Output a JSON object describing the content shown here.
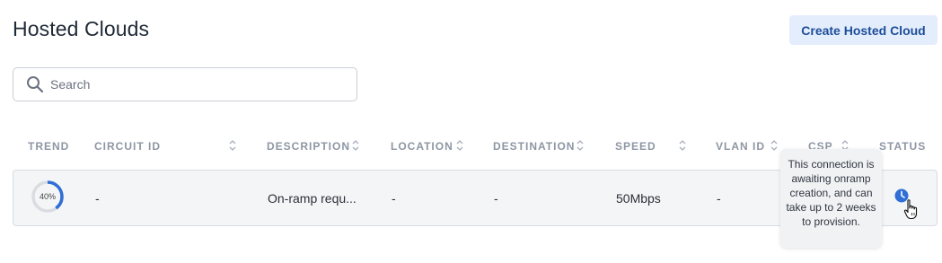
{
  "page": {
    "title": "Hosted Clouds"
  },
  "toolbar": {
    "create_label": "Create Hosted Cloud"
  },
  "search": {
    "placeholder": "Search",
    "value": ""
  },
  "table": {
    "columns": [
      "TREND",
      "CIRCUIT ID",
      "DESCRIPTION",
      "LOCATION",
      "DESTINATION",
      "SPEED",
      "VLAN ID",
      "CSP",
      "STATUS"
    ],
    "rows": [
      {
        "trend_percent": 40,
        "trend_label": "40%",
        "circuit_id": "-",
        "description": "On-ramp requ...",
        "location": "-",
        "destination": "-",
        "speed": "50Mbps",
        "vlan_id": "-",
        "status_icon": "clock-icon"
      }
    ]
  },
  "tooltip": {
    "text": "This connection is awaiting onramp creation, and can take up to 2 weeks to provision."
  },
  "colors": {
    "accent": "#2f6fd6",
    "button_bg": "#e4edfb",
    "button_text": "#1d4e9a",
    "ring_track": "#d9dce1"
  }
}
